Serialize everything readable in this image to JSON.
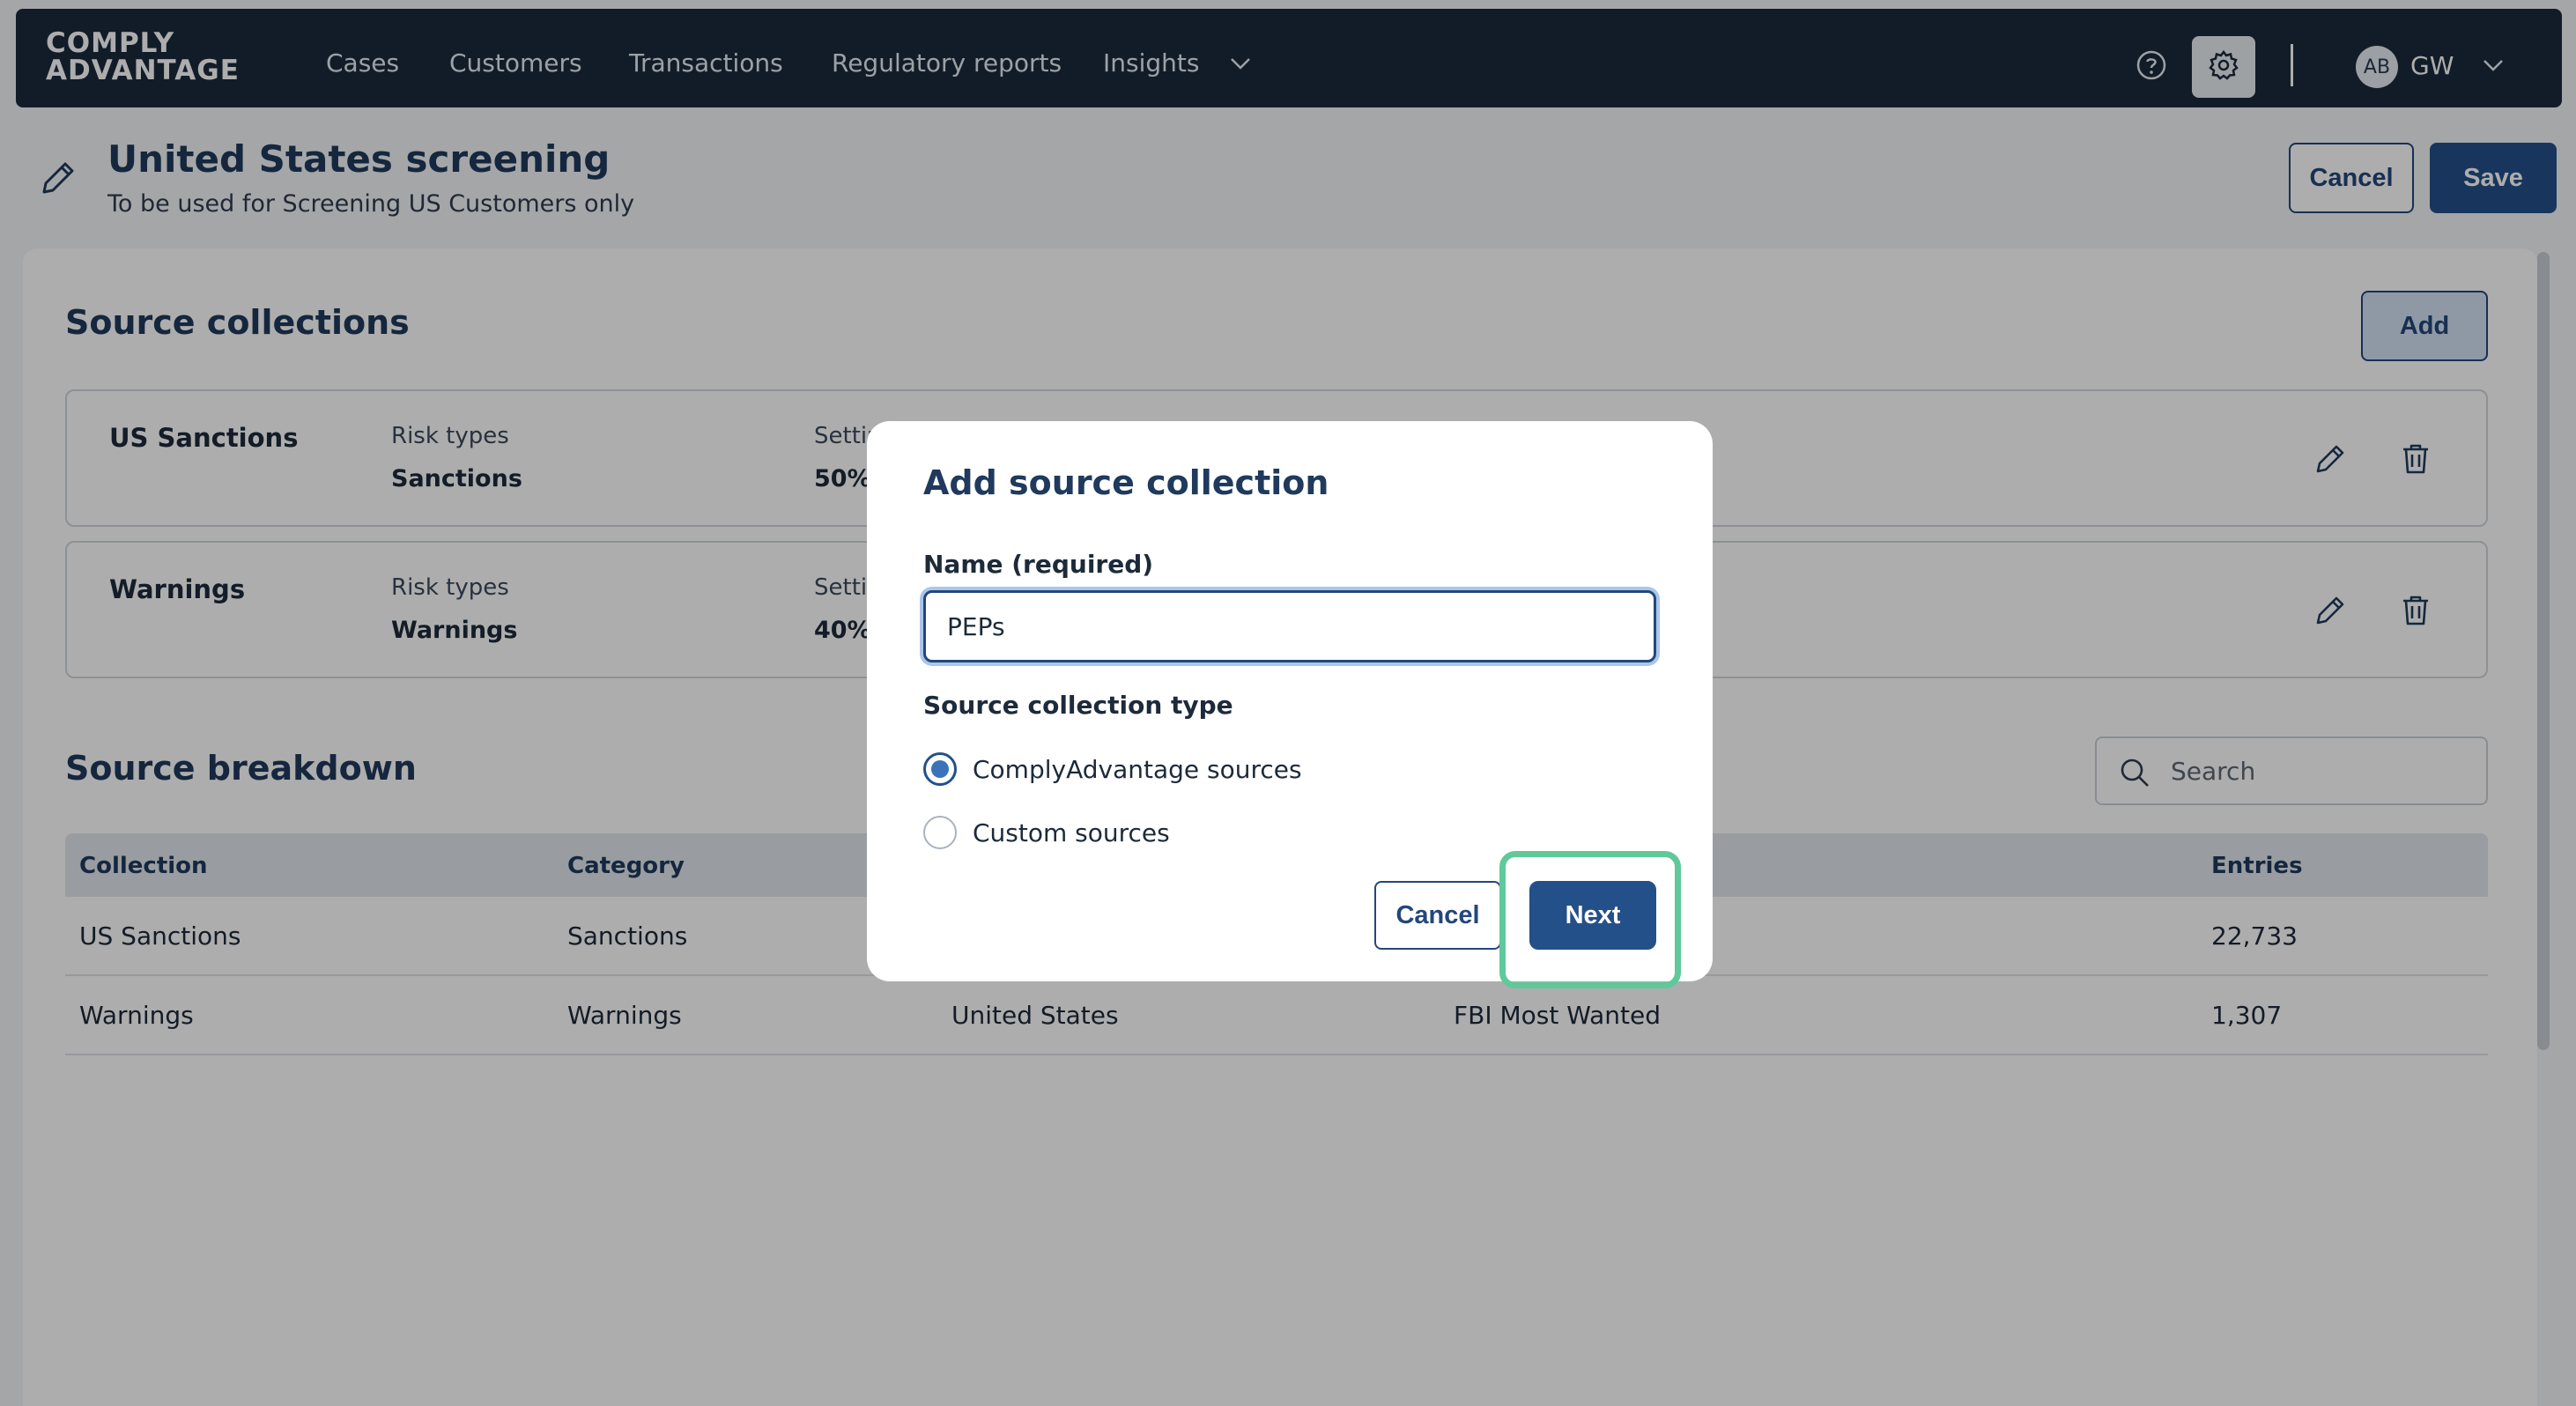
{
  "brand": {
    "logo_line1": "COMPLY",
    "logo_line2": "ADVANTAGE"
  },
  "nav": {
    "items": [
      "Cases",
      "Customers",
      "Transactions",
      "Regulatory reports",
      "Insights"
    ],
    "user_avatar": "AB",
    "user_initials": "GW"
  },
  "header": {
    "title": "United States screening",
    "subtitle": "To be used for Screening US Customers only",
    "cancel_label": "Cancel",
    "save_label": "Save"
  },
  "source_collections": {
    "title": "Source collections",
    "add_label": "Add",
    "rows": [
      {
        "name": "US Sanctions",
        "risk_label": "Risk types",
        "risk_value": "Sanctions",
        "setting_label": "Settin",
        "setting_value": "50%"
      },
      {
        "name": "Warnings",
        "risk_label": "Risk types",
        "risk_value": "Warnings",
        "setting_label": "Settin",
        "setting_value": "40%"
      }
    ]
  },
  "source_breakdown": {
    "title": "Source breakdown",
    "search_placeholder": "Search",
    "columns": [
      "Collection",
      "Category",
      "",
      "",
      "Entries"
    ],
    "rows": [
      {
        "collection": "US Sanctions",
        "category": "Sanctions",
        "country": "",
        "source": "",
        "entries": "22,733"
      },
      {
        "collection": "Warnings",
        "category": "Warnings",
        "country": "United States",
        "source": "FBI Most Wanted",
        "entries": "1,307"
      }
    ]
  },
  "modal": {
    "title": "Add source collection",
    "name_label": "Name (required)",
    "name_value": "PEPs",
    "type_label": "Source collection type",
    "options": [
      {
        "label": "ComplyAdvantage sources",
        "checked": true
      },
      {
        "label": "Custom sources",
        "checked": false
      }
    ],
    "cancel_label": "Cancel",
    "next_label": "Next"
  },
  "icons": {
    "nav_chevron": "chevron-down-icon",
    "help": "help-circle-icon",
    "settings": "gear-icon",
    "edit": "pencil-icon",
    "delete": "trash-icon",
    "search": "search-icon"
  },
  "colors": {
    "nav_bg": "#1b2a3d",
    "primary": "#24508a",
    "highlight": "#5fc99a"
  }
}
